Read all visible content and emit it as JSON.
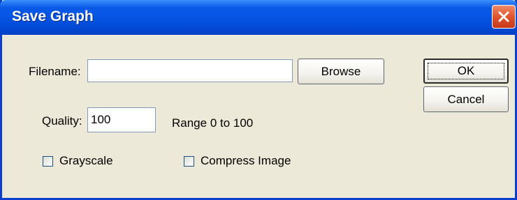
{
  "dialog": {
    "title": "Save Graph",
    "close_icon": "close-icon"
  },
  "filename": {
    "label": "Filename:",
    "value": "",
    "browse_label": "Browse"
  },
  "quality": {
    "label": "Quality:",
    "value": "100",
    "range_text": "Range 0 to 100"
  },
  "options": {
    "grayscale": {
      "label": "Grayscale",
      "checked": false
    },
    "compress": {
      "label": "Compress Image",
      "checked": false
    }
  },
  "buttons": {
    "ok_label": "OK",
    "cancel_label": "Cancel"
  },
  "colors": {
    "titlebar": "#0451e0",
    "dialog_bg": "#ece9d8",
    "close_button": "#e0542c"
  }
}
